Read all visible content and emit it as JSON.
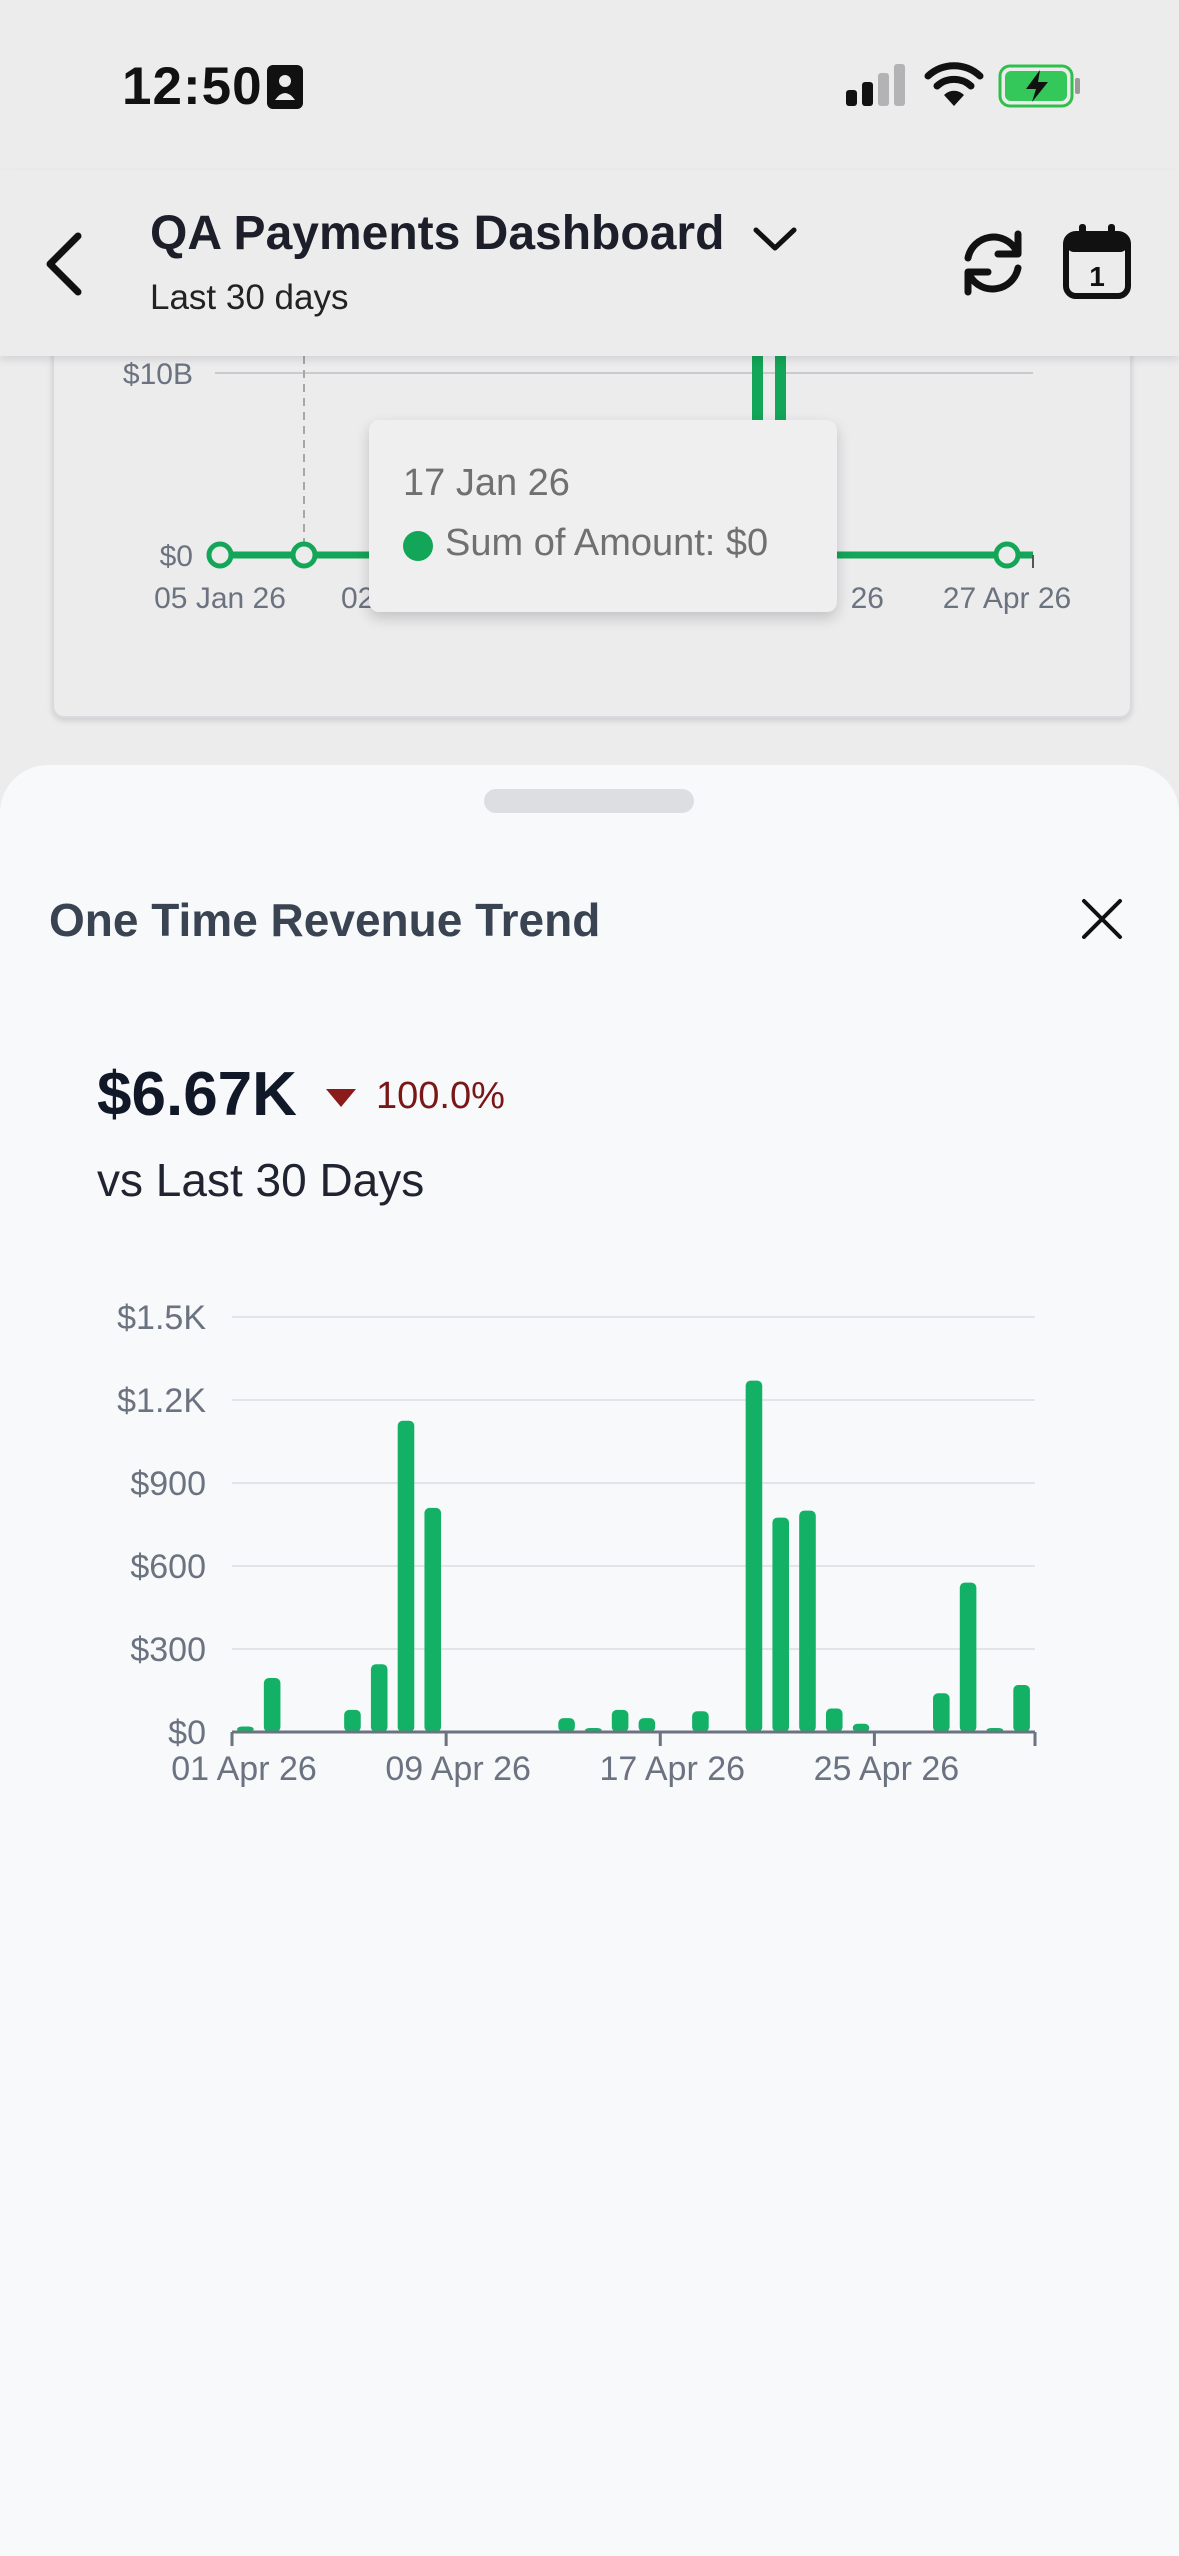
{
  "status_bar": {
    "time": "12:50"
  },
  "header": {
    "title": "QA Payments Dashboard",
    "subtitle": "Last 30 days"
  },
  "background_card": {
    "y_labels": [
      "$10B",
      "$0"
    ],
    "x_labels": [
      "05 Jan 26",
      "02",
      "26",
      "27 Apr 26"
    ],
    "tooltip": {
      "date": "17 Jan 26",
      "value": "Sum of Amount: $0"
    }
  },
  "sheet": {
    "title": "One Time Revenue Trend",
    "kpi": {
      "value": "$6.67K",
      "change": "100.0%",
      "compare": "vs Last 30 Days"
    }
  },
  "colors": {
    "accent": "#13b165",
    "negative": "#7a1616",
    "text": "#111827"
  },
  "chart_data": {
    "type": "bar",
    "title": "",
    "xlabel": "",
    "ylabel": "",
    "ylim": [
      0,
      1500
    ],
    "yticks": [
      {
        "value": 0,
        "label": "$0"
      },
      {
        "value": 300,
        "label": "$300"
      },
      {
        "value": 600,
        "label": "$600"
      },
      {
        "value": 900,
        "label": "$900"
      },
      {
        "value": 1200,
        "label": "$1.2K"
      },
      {
        "value": 1500,
        "label": "$1.5K"
      }
    ],
    "xticks": [
      {
        "day": 1,
        "label": "01 Apr 26"
      },
      {
        "day": 9,
        "label": "09 Apr 26"
      },
      {
        "day": 17,
        "label": "17 Apr 26"
      },
      {
        "day": 25,
        "label": "25 Apr 26"
      }
    ],
    "categories": [
      "01 Apr 26",
      "02 Apr 26",
      "03 Apr 26",
      "04 Apr 26",
      "05 Apr 26",
      "06 Apr 26",
      "07 Apr 26",
      "08 Apr 26",
      "09 Apr 26",
      "10 Apr 26",
      "11 Apr 26",
      "12 Apr 26",
      "13 Apr 26",
      "14 Apr 26",
      "15 Apr 26",
      "16 Apr 26",
      "17 Apr 26",
      "18 Apr 26",
      "19 Apr 26",
      "20 Apr 26",
      "21 Apr 26",
      "22 Apr 26",
      "23 Apr 26",
      "24 Apr 26",
      "25 Apr 26",
      "26 Apr 26",
      "27 Apr 26",
      "28 Apr 26",
      "29 Apr 26",
      "30 Apr 26"
    ],
    "values": [
      20,
      195,
      0,
      0,
      80,
      245,
      1125,
      810,
      0,
      0,
      0,
      0,
      50,
      5,
      80,
      50,
      0,
      75,
      0,
      1270,
      775,
      800,
      85,
      30,
      0,
      0,
      140,
      540,
      5,
      170
    ],
    "grid": true,
    "legend": "none"
  }
}
